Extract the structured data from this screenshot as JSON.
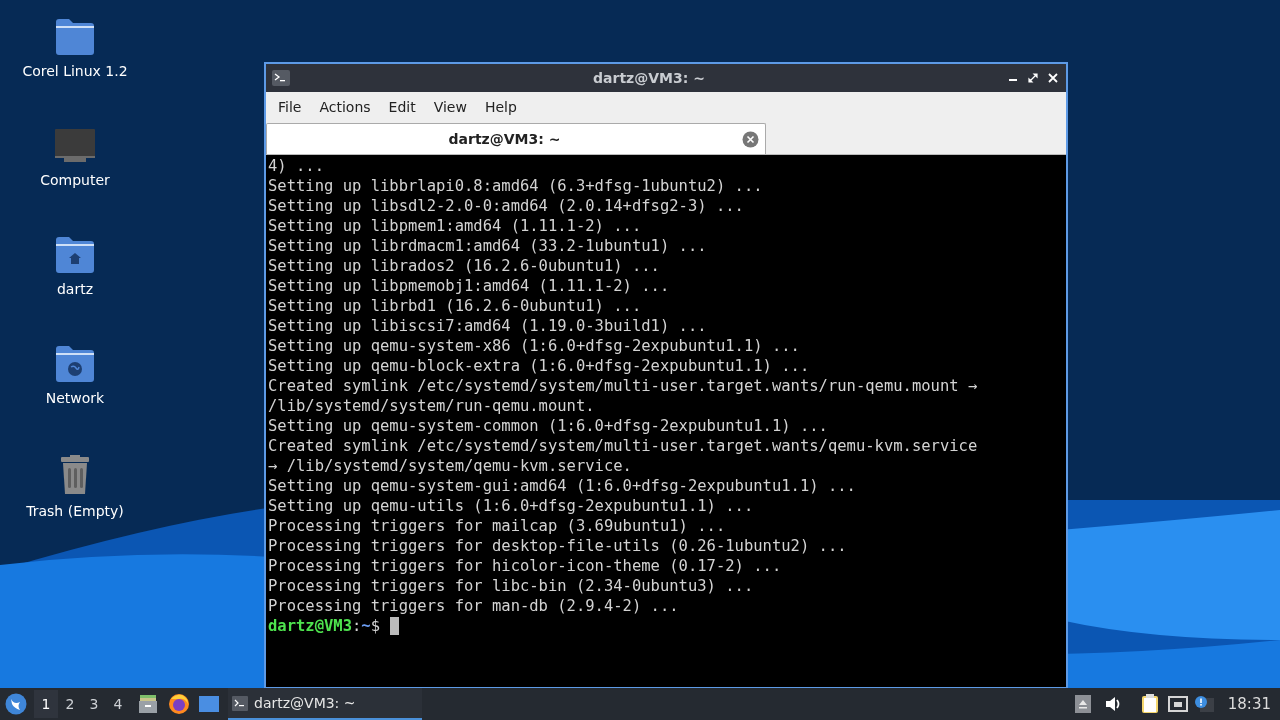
{
  "desktop_icons": [
    {
      "kind": "folder",
      "label": "Corel Linux 1.2"
    },
    {
      "kind": "computer",
      "label": "Computer"
    },
    {
      "kind": "home",
      "label": "dartz"
    },
    {
      "kind": "network",
      "label": "Network"
    },
    {
      "kind": "trash",
      "label": "Trash (Empty)"
    }
  ],
  "window": {
    "title": "dartz@VM3: ~",
    "menu": [
      "File",
      "Actions",
      "Edit",
      "View",
      "Help"
    ],
    "tabs": [
      {
        "label": "dartz@VM3: ~",
        "selected": true
      }
    ],
    "terminal_lines": [
      "4) ...",
      "Setting up libbrlapi0.8:amd64 (6.3+dfsg-1ubuntu2) ...",
      "Setting up libsdl2-2.0-0:amd64 (2.0.14+dfsg2-3) ...",
      "Setting up libpmem1:amd64 (1.11.1-2) ...",
      "Setting up librdmacm1:amd64 (33.2-1ubuntu1) ...",
      "Setting up librados2 (16.2.6-0ubuntu1) ...",
      "Setting up libpmemobj1:amd64 (1.11.1-2) ...",
      "Setting up librbd1 (16.2.6-0ubuntu1) ...",
      "Setting up libiscsi7:amd64 (1.19.0-3build1) ...",
      "Setting up qemu-system-x86 (1:6.0+dfsg-2expubuntu1.1) ...",
      "Setting up qemu-block-extra (1:6.0+dfsg-2expubuntu1.1) ...",
      "Created symlink /etc/systemd/system/multi-user.target.wants/run-qemu.mount →",
      "/lib/systemd/system/run-qemu.mount.",
      "Setting up qemu-system-common (1:6.0+dfsg-2expubuntu1.1) ...",
      "Created symlink /etc/systemd/system/multi-user.target.wants/qemu-kvm.service",
      "→ /lib/systemd/system/qemu-kvm.service.",
      "Setting up qemu-system-gui:amd64 (1:6.0+dfsg-2expubuntu1.1) ...",
      "Setting up qemu-utils (1:6.0+dfsg-2expubuntu1.1) ...",
      "Processing triggers for mailcap (3.69ubuntu1) ...",
      "Processing triggers for desktop-file-utils (0.26-1ubuntu2) ...",
      "Processing triggers for hicolor-icon-theme (0.17-2) ...",
      "Processing triggers for libc-bin (2.34-0ubuntu3) ...",
      "Processing triggers for man-db (2.9.4-2) ..."
    ],
    "prompt": {
      "user": "dartz@VM3",
      "separator": ":",
      "path": "~",
      "symbol": "$"
    }
  },
  "taskbar": {
    "workspaces": [
      {
        "label": "1",
        "selected": true
      },
      {
        "label": "2",
        "selected": false
      },
      {
        "label": "3",
        "selected": false
      },
      {
        "label": "4",
        "selected": false
      }
    ],
    "tasks": [
      {
        "label": "dartz@VM3: ~",
        "selected": true
      }
    ],
    "clock": "18:31"
  }
}
